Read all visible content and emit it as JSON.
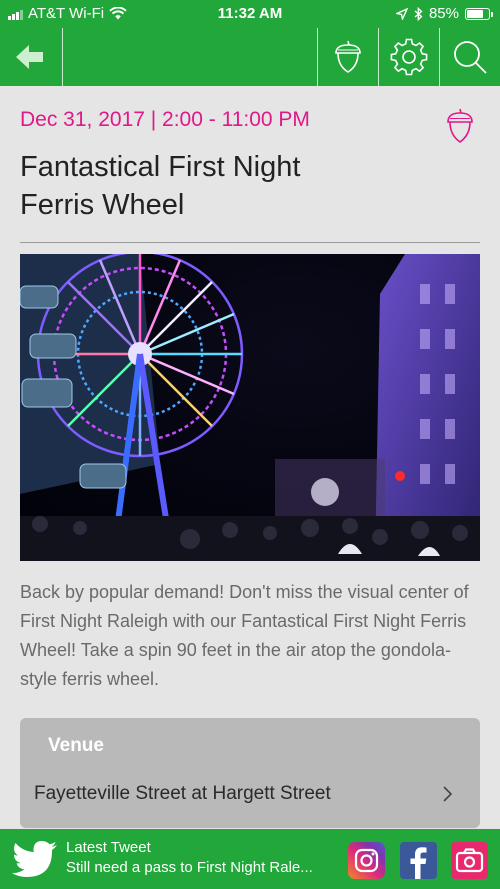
{
  "status_bar": {
    "carrier": "AT&T Wi-Fi",
    "time": "11:32 AM",
    "battery": "85%",
    "battery_level": 0.85
  },
  "nav": {
    "icons": [
      "back-arrow-icon",
      "acorn-icon",
      "gear-icon",
      "search-icon"
    ]
  },
  "event": {
    "date": "Dec 31, 2017 | 2:00 - 11:00 PM",
    "title": "Fantastical First Night Ferris Wheel",
    "description": "Back by popular demand! Don't miss the visual center of First Night Raleigh with our Fantastical First Night Ferris Wheel! Take a spin 90 feet in the air atop the gondola-style ferris wheel.",
    "favorite_icon": "acorn-outline-icon"
  },
  "venue": {
    "heading": "Venue",
    "name": "Fayetteville Street at Hargett Street"
  },
  "footer": {
    "label": "Latest Tweet",
    "tweet": "Still need a pass to First Night Rale...",
    "social": [
      "instagram-icon",
      "facebook-icon",
      "camera-icon"
    ]
  },
  "colors": {
    "brand_green": "#22a83a",
    "accent_magenta": "#e0198a",
    "background": "#e5e5e5",
    "card_gray": "#b9b9b9"
  }
}
